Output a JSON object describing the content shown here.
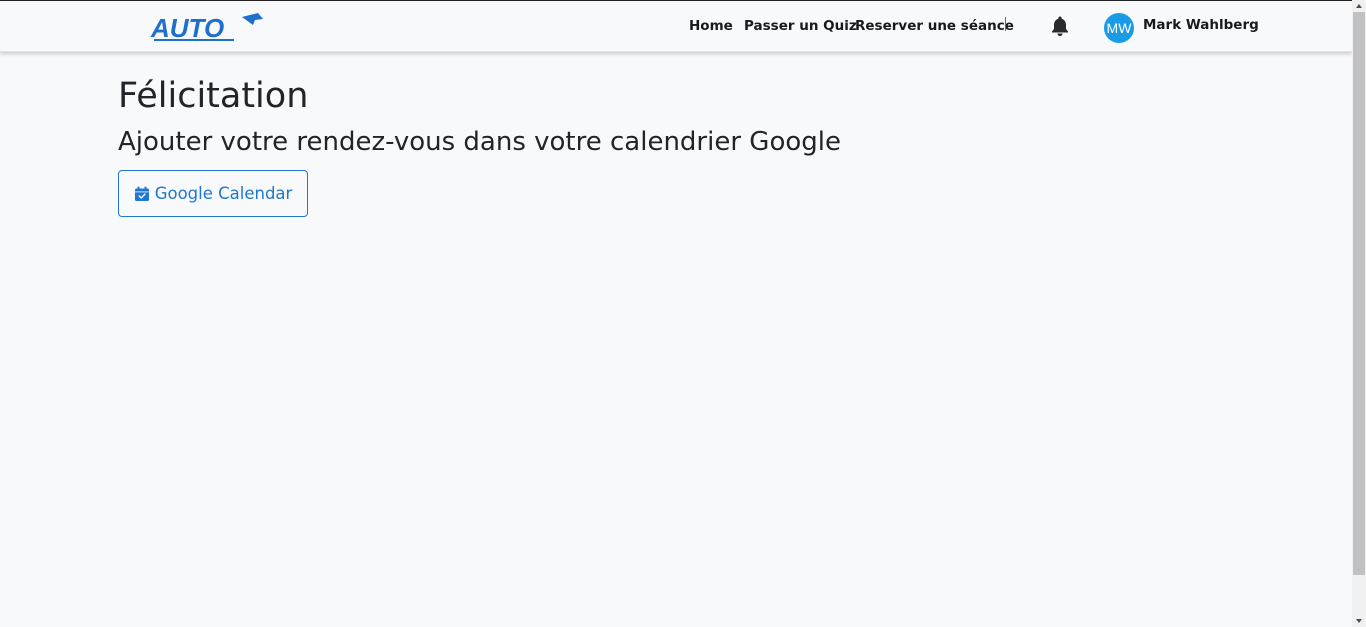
{
  "navbar": {
    "logo_text": "AUTO",
    "links": [
      {
        "label": "Home"
      },
      {
        "label": "Passer un Quiz"
      },
      {
        "label": "Reserver une séance"
      }
    ],
    "user": {
      "initials": "MW",
      "name": "Mark Wahlberg"
    }
  },
  "main": {
    "title": "Félicitation",
    "subtitle": "Ajouter votre rendez-vous dans votre calendrier Google",
    "calendar_button_label": "Google Calendar"
  },
  "colors": {
    "brand_blue": "#1f77d0",
    "avatar_bg": "#1a9be6",
    "page_bg": "#f8f9fb"
  },
  "icons": [
    "bell-icon",
    "calendar-check-icon"
  ]
}
